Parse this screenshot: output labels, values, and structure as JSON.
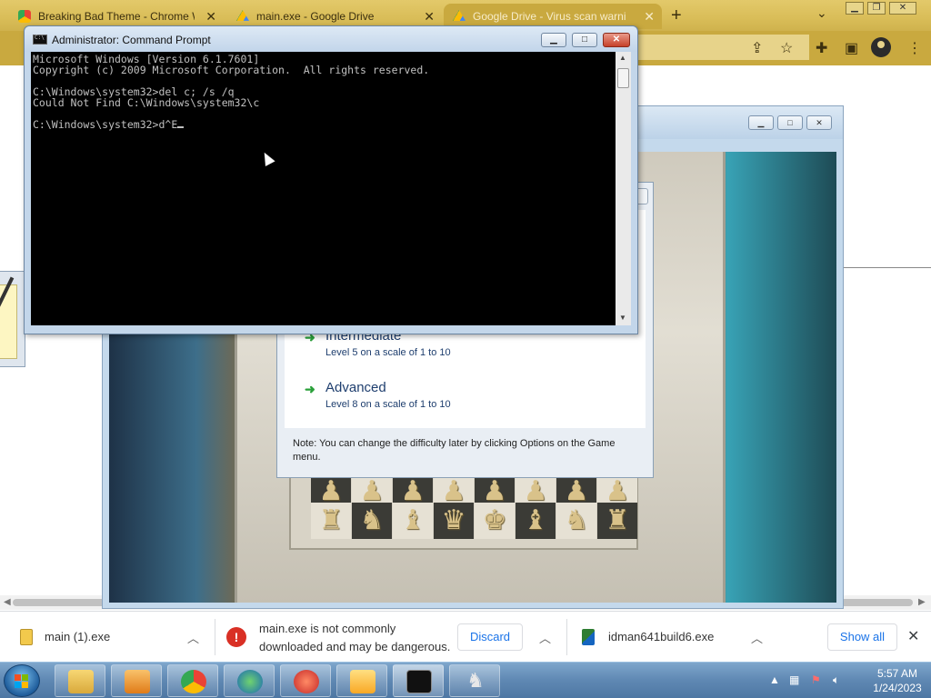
{
  "browser": {
    "tabs": [
      {
        "title": "Breaking Bad Theme - Chrome W",
        "icon": "chrome-webstore-icon",
        "active": false
      },
      {
        "title": "main.exe - Google Drive",
        "icon": "google-drive-icon",
        "active": false
      },
      {
        "title": "Google Drive - Virus scan warni",
        "icon": "google-drive-icon",
        "active": true
      }
    ],
    "new_tab_label": "+",
    "tab_close_label": "✕"
  },
  "cmd": {
    "title": "Administrator: Command Prompt",
    "lines": [
      "Microsoft Windows [Version 6.1.7601]",
      "Copyright (c) 2009 Microsoft Corporation.  All rights reserved.",
      "",
      "C:\\Windows\\system32>del c; /s /q",
      "Could Not Find C:\\Windows\\system32\\c",
      ""
    ],
    "prompt": "C:\\Windows\\system32>d^E"
  },
  "chess": {
    "options": [
      {
        "name": "Intermediate",
        "desc": "Level 5 on a scale of 1 to 10"
      },
      {
        "name": "Advanced",
        "desc": "Level 8 on a scale of 1 to 10"
      }
    ],
    "note": "Note: You can change the difficulty later by clicking Options on the Game menu.",
    "pawns": [
      "♟",
      "♟",
      "♟",
      "♟",
      "♟",
      "♟",
      "♟",
      "♟"
    ],
    "back_rank": [
      "♜",
      "♞",
      "♝",
      "♛",
      "♚",
      "♝",
      "♞",
      "♜"
    ]
  },
  "downloads": {
    "items": [
      {
        "name": "main (1).exe"
      },
      {
        "name": "main.exe is not commonly",
        "name2": "downloaded and may be dangerous.",
        "action": "Discard"
      },
      {
        "name": "idman641build6.exe"
      }
    ],
    "show_all": "Show all"
  },
  "taskbar": {
    "time": "5:57 AM",
    "date": "1/24/2023"
  },
  "colors": {
    "chrome_frame": "#d9bd58",
    "download_link": "#1a73e8",
    "warning": "#d93025"
  }
}
